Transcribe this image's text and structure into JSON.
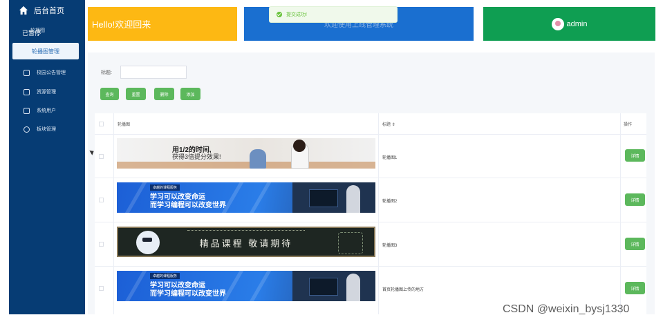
{
  "sidebar": {
    "home_label": "后台首页",
    "paused_label": "已暂停",
    "paused_overlay": "轮播图",
    "active_label": "轮播图管理",
    "items": [
      {
        "icon": "edit-icon",
        "label": "校园公告管理"
      },
      {
        "icon": "resource-icon",
        "label": "资源管理"
      },
      {
        "icon": "user-icon",
        "label": "系统用户"
      },
      {
        "icon": "chat-icon",
        "label": "板块管理"
      }
    ]
  },
  "header": {
    "welcome": "Hello!欢迎回来",
    "blue_card_text": "欢迎使用上线管理系统",
    "username": "admin"
  },
  "toast": {
    "text": "提交成功!"
  },
  "search": {
    "label": "标题:",
    "value": "",
    "buttons": [
      "查询",
      "重置",
      "删除",
      "添加"
    ]
  },
  "table": {
    "headers": {
      "image": "轮播图",
      "title": "标题 ⇕",
      "action": "操作"
    },
    "rows": [
      {
        "title": "轮播图1",
        "action": "详情",
        "banner_line1": "用1/2的时间,",
        "banner_line2": "获得3倍提分效果!"
      },
      {
        "title": "轮播图2",
        "action": "详情",
        "banner_tag": "卓越的课程服务",
        "banner_line1": "学习可以改变命运",
        "banner_line2": "而学习编程可以改变世界"
      },
      {
        "title": "轮播图3",
        "action": "详情",
        "banner_line1": "精品课程 敬请期待"
      },
      {
        "title": "首页轮播图上传的地方",
        "action": "详情",
        "banner_tag": "卓越的课程服务",
        "banner_line1": "学习可以改变命运",
        "banner_line2": "而学习编程可以改变世界"
      }
    ]
  },
  "watermark": "CSDN @weixin_bysj1330",
  "colors": {
    "sidebar": "#063c74",
    "yellow": "#fdb813",
    "blue": "#1a6fd0",
    "green": "#0f9e52",
    "button": "#5cb85c"
  }
}
